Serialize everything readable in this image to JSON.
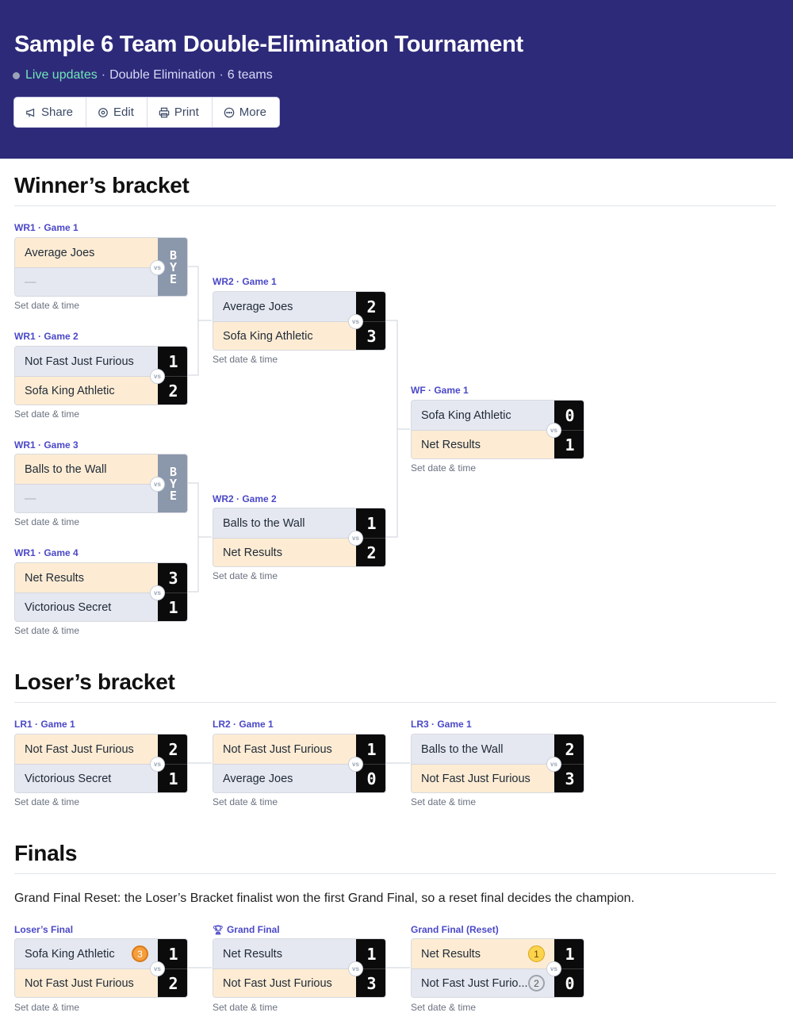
{
  "header": {
    "title": "Sample 6 Team Double-Elimination Tournament",
    "live": "Live updates",
    "format": "Double Elimination",
    "teams": "6 teams",
    "separator": "·",
    "background": "#2e2a7a",
    "toolbar": {
      "share": "Share",
      "edit": "Edit",
      "print": "Print",
      "more": "More"
    }
  },
  "common": {
    "vs": "vs",
    "set_date": "Set date & time",
    "bye": [
      "B",
      "Y",
      "E"
    ],
    "empty_team": "—"
  },
  "winners": {
    "title": "Winner’s bracket",
    "wr1g1": {
      "label": "WR1 · Game 1",
      "team1": "Average Joes"
    },
    "wr1g2": {
      "label": "WR1 · Game 2",
      "team1": "Not Fast Just Furious",
      "team2": "Sofa King Athletic",
      "score1": "1",
      "score2": "2"
    },
    "wr1g3": {
      "label": "WR1 · Game 3",
      "team1": "Balls to the Wall"
    },
    "wr1g4": {
      "label": "WR1 · Game 4",
      "team1": "Net Results",
      "team2": "Victorious Secret",
      "score1": "3",
      "score2": "1"
    },
    "wr2g1": {
      "label": "WR2 · Game 1",
      "team1": "Average Joes",
      "team2": "Sofa King Athletic",
      "score1": "2",
      "score2": "3"
    },
    "wr2g2": {
      "label": "WR2 · Game 2",
      "team1": "Balls to the Wall",
      "team2": "Net Results",
      "score1": "1",
      "score2": "2"
    },
    "wf": {
      "label": "WF · Game 1",
      "team1": "Sofa King Athletic",
      "team2": "Net Results",
      "score1": "0",
      "score2": "1"
    }
  },
  "losers": {
    "title": "Loser’s bracket",
    "lr1": {
      "label": "LR1 · Game 1",
      "team1": "Not Fast Just Furious",
      "team2": "Victorious Secret",
      "score1": "2",
      "score2": "1"
    },
    "lr2": {
      "label": "LR2 · Game 1",
      "team1": "Not Fast Just Furious",
      "team2": "Average Joes",
      "score1": "1",
      "score2": "0"
    },
    "lr3": {
      "label": "LR3 · Game 1",
      "team1": "Balls to the Wall",
      "team2": "Not Fast Just Furious",
      "score1": "2",
      "score2": "3"
    }
  },
  "finals": {
    "title": "Finals",
    "note": "Grand Final Reset: the Loser’s Bracket finalist won the first Grand Final, so a reset final decides the champion.",
    "lf": {
      "label": "Loser’s Final",
      "team1": "Sofa King Athletic",
      "team2": "Not Fast Just Furious",
      "score1": "1",
      "score2": "2",
      "medal1": "3"
    },
    "gf": {
      "label": "Grand Final",
      "team1": "Net Results",
      "team2": "Not Fast Just Furious",
      "score1": "1",
      "score2": "3"
    },
    "gfr": {
      "label": "Grand Final (Reset)",
      "team1": "Net Results",
      "team2": "Not Fast Just Furio...",
      "score1": "1",
      "score2": "0",
      "medal1": "1",
      "medal2": "2"
    }
  }
}
